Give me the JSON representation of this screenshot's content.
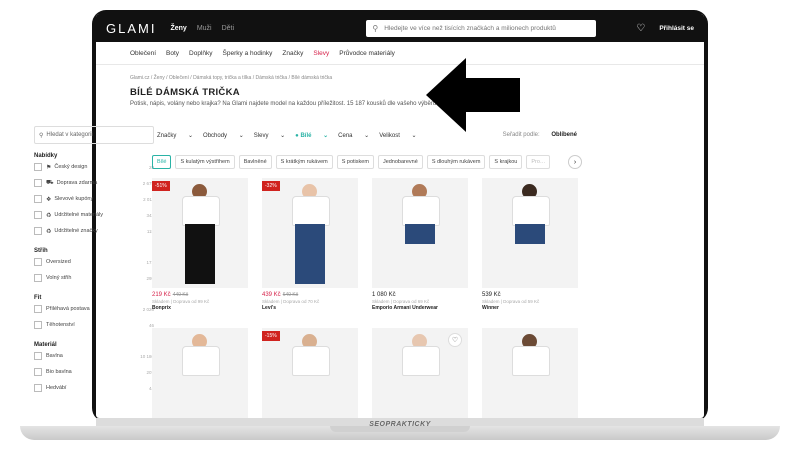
{
  "header": {
    "logo": "GLAMI",
    "nav": [
      "Ženy",
      "Muži",
      "Děti"
    ],
    "search_placeholder": "Hledejte ve více než tisících značkách a milionech produktů",
    "login": "Přihlásit se"
  },
  "categories": [
    "Oblečení",
    "Boty",
    "Doplňky",
    "Šperky a hodinky",
    "Značky",
    "Slevy",
    "Průvodce materiály"
  ],
  "breadcrumbs": "Glami.cz  /  Ženy  /  Oblečení  /  Dámská topy, trička a tílka  /  Dámská trička  /  Bílé dámská trička",
  "page": {
    "title": "BÍLÉ DÁMSKÁ TRIČKA",
    "subtitle": "Potisk, nápis, volány nebo krajka? Na Glami najdete model na každou příležitost. 15 187 kousků dle vašeho výběru z 384 obchodů."
  },
  "filters": {
    "search_placeholder": "Hledat v kategorii",
    "sections": [
      {
        "title": "Nabídky",
        "items": [
          {
            "label": "Český design",
            "count": "28"
          },
          {
            "label": "Doprava zdarma",
            "count": "2 675"
          },
          {
            "label": "Slevové kupóny",
            "count": "2 011"
          },
          {
            "label": "Udržitelné materiály",
            "count": "343"
          },
          {
            "label": "Udržitelné značky",
            "count": "115"
          }
        ]
      },
      {
        "title": "Střih",
        "items": [
          {
            "label": "Oversized",
            "count": "171"
          },
          {
            "label": "Volný střih",
            "count": "295"
          }
        ]
      },
      {
        "title": "Fit",
        "items": [
          {
            "label": "Přiléhavá postava",
            "count": "2 026"
          },
          {
            "label": "Těhotenství",
            "count": "46"
          }
        ]
      },
      {
        "title": "Materiál",
        "items": [
          {
            "label": "Bavlna",
            "count": "10 186"
          },
          {
            "label": "Bio bavlna",
            "count": "207"
          },
          {
            "label": "Hedvábí",
            "count": "44"
          }
        ]
      }
    ]
  },
  "toolbar": {
    "items": [
      "Značky",
      "Obchody",
      "Slevy",
      "Bílé",
      "Cena",
      "Velikost"
    ],
    "sort_label": "Seřadit podle:",
    "sort_value": "Oblíbené"
  },
  "chips": [
    "Bílé",
    "S kulatým výstřihem",
    "Bavlněné",
    "S krátkým rukávem",
    "S potiskem",
    "Jednobarevné",
    "S dlouhým rukávem",
    "S krajkou",
    "Pro…"
  ],
  "products": [
    {
      "discount": "-51%",
      "price": "219 Kč",
      "old_price": "449 Kč",
      "shipping": "Skladem | Doprava od 99 Kč",
      "brand": "Bonprix"
    },
    {
      "discount": "-32%",
      "price": "439 Kč",
      "old_price": "649 Kč",
      "shipping": "Skladem | Doprava od 70 Kč",
      "brand": "Levi's"
    },
    {
      "discount": "",
      "price": "1 080 Kč",
      "old_price": "",
      "shipping": "Skladem | Doprava od 69 Kč",
      "brand": "Emporio Armani Underwear"
    },
    {
      "discount": "",
      "price": "539 Kč",
      "old_price": "",
      "shipping": "Skladem | Doprava od 59 Kč",
      "brand": "Winner"
    },
    {
      "discount": "",
      "price": "",
      "old_price": "",
      "shipping": "",
      "brand": ""
    },
    {
      "discount": "-15%",
      "price": "",
      "old_price": "",
      "shipping": "",
      "brand": ""
    },
    {
      "discount": "",
      "price": "",
      "old_price": "",
      "shipping": "",
      "brand": ""
    },
    {
      "discount": "",
      "price": "",
      "old_price": "",
      "shipping": "",
      "brand": ""
    }
  ],
  "footer_brand": "SEOPRAKTICKY",
  "colors": {
    "accent": "#2ab3a6",
    "sale": "#d6224a",
    "discount_badge": "#d0231f",
    "topbar": "#111111"
  }
}
